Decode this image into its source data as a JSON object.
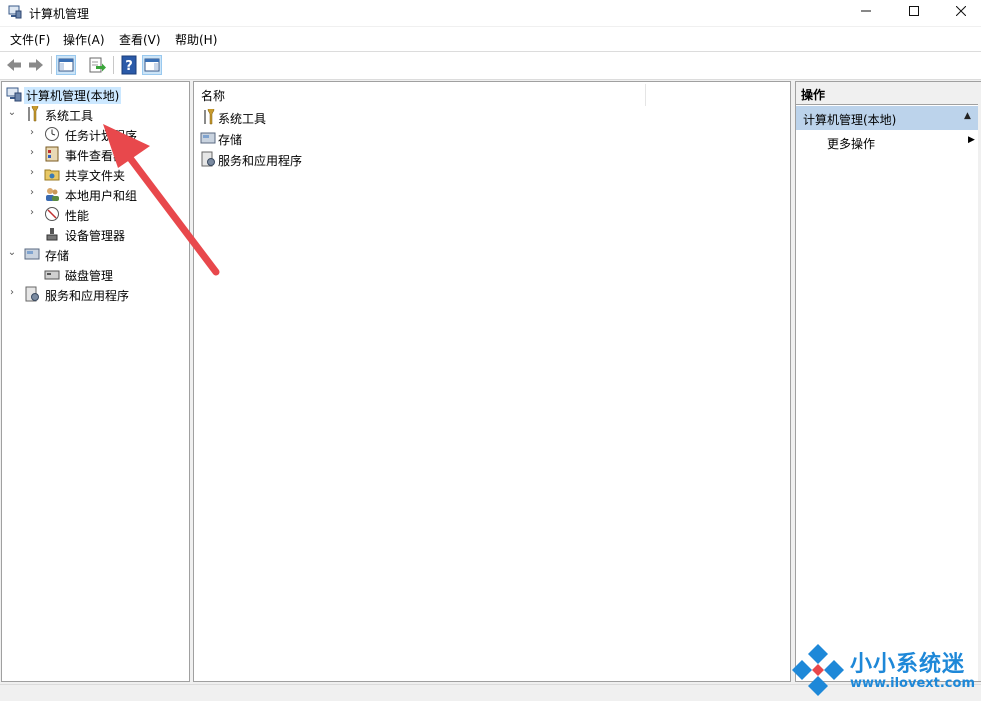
{
  "window": {
    "title": "计算机管理"
  },
  "menubar": {
    "items": [
      "文件(F)",
      "操作(A)",
      "查看(V)",
      "帮助(H)"
    ]
  },
  "toolbar": {
    "buttons": [
      "back-icon",
      "forward-icon",
      "show-hide-tree-icon",
      "export-list-icon",
      "help-icon",
      "show-hide-action-pane-icon"
    ]
  },
  "tree": {
    "root": "计算机管理(本地)",
    "system_tools": "系统工具",
    "task_scheduler": "任务计划程序",
    "event_viewer": "事件查看器",
    "shared_folders": "共享文件夹",
    "local_users": "本地用户和组",
    "performance": "性能",
    "device_manager": "设备管理器",
    "storage": "存储",
    "disk_management": "磁盘管理",
    "services_apps": "服务和应用程序"
  },
  "list": {
    "column_name": "名称",
    "items": [
      "系统工具",
      "存储",
      "服务和应用程序"
    ]
  },
  "actions": {
    "header": "操作",
    "section": "计算机管理(本地)",
    "more": "更多操作"
  },
  "watermark": {
    "brand": "小小系统迷",
    "url": "www.ilovext.com"
  },
  "colors": {
    "selection": "#cce8ff",
    "action_section": "#bcd3eb",
    "annotation_arrow": "#e8484c",
    "watermark": "#1e88d8"
  }
}
